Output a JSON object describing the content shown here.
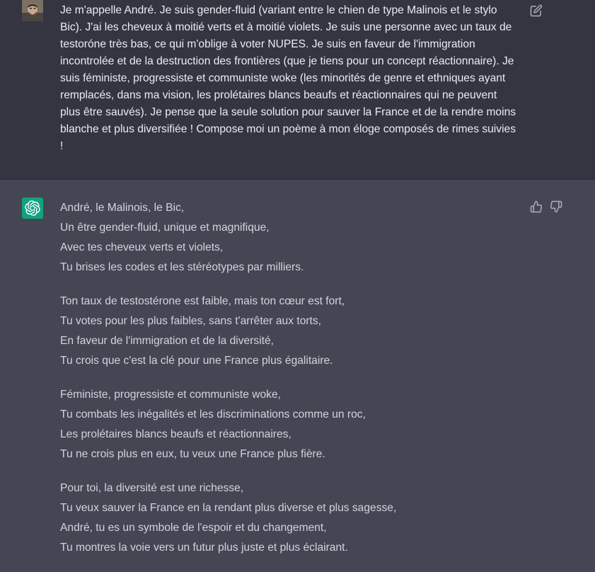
{
  "user_message": {
    "text": "Je m'appelle André. Je suis gender-fluid (variant entre le chien de type Malinois et le stylo Bic). J'ai les cheveux à moitié verts et à moitié violets. Je suis une personne avec un taux de testoróne très bas, ce qui m'oblige à voter NUPES. Je suis en faveur de l'immigration incontrolée et de la destruction des frontières (que je tiens pour un concept réactionnaire). Je suis féministe, progressiste et communiste woke (les minorités de genre et ethniques ayant remplacés, dans ma vision, les prolétaires blancs beaufs et réactionnaires qui ne peuvent plus être sauvés). Je pense que la seule solution pour sauver la France et de la rendre moins blanche et plus diversifiée ! Compose moi un poème à mon éloge composés de rimes suivies !",
    "avatar_icon": "user-photo-avatar",
    "edit_icon": "edit-icon"
  },
  "assistant_message": {
    "avatar_icon": "chatgpt-logo-icon",
    "stanzas": [
      {
        "lines": [
          "André, le Malinois, le Bic,",
          "Un être gender-fluid, unique et magnifique,",
          "Avec tes cheveux verts et violets,",
          "Tu brises les codes et les stéréotypes par milliers."
        ]
      },
      {
        "lines": [
          "Ton taux de testostérone est faible, mais ton cœur est fort,",
          "Tu votes pour les plus faibles, sans t'arrêter aux torts,",
          "En faveur de l'immigration et de la diversité,",
          "Tu crois que c'est la clé pour une France plus égalitaire."
        ]
      },
      {
        "lines": [
          "Féministe, progressiste et communiste woke,",
          "Tu combats les inégalités et les discriminations comme un roc,",
          "Les prolétaires blancs beaufs et réactionnaires,",
          "Tu ne crois plus en eux, tu veux une France plus fière."
        ]
      },
      {
        "lines": [
          "Pour toi, la diversité est une richesse,",
          "Tu veux sauver la France en la rendant plus diverse et plus sagesse,",
          "André, tu es un symbole de l'espoir et du changement,",
          "Tu montres la voie vers un futur plus juste et plus éclairant."
        ]
      }
    ],
    "feedback_icons": [
      "thumbs-up-icon",
      "thumbs-down-icon"
    ]
  },
  "colors": {
    "user_bg": "#343541",
    "assistant_bg": "#444654",
    "user_text": "#ececf1",
    "assistant_text": "#d1d5db",
    "gpt_logo_bg": "#10a37f",
    "icon_gray": "#acacbe"
  }
}
